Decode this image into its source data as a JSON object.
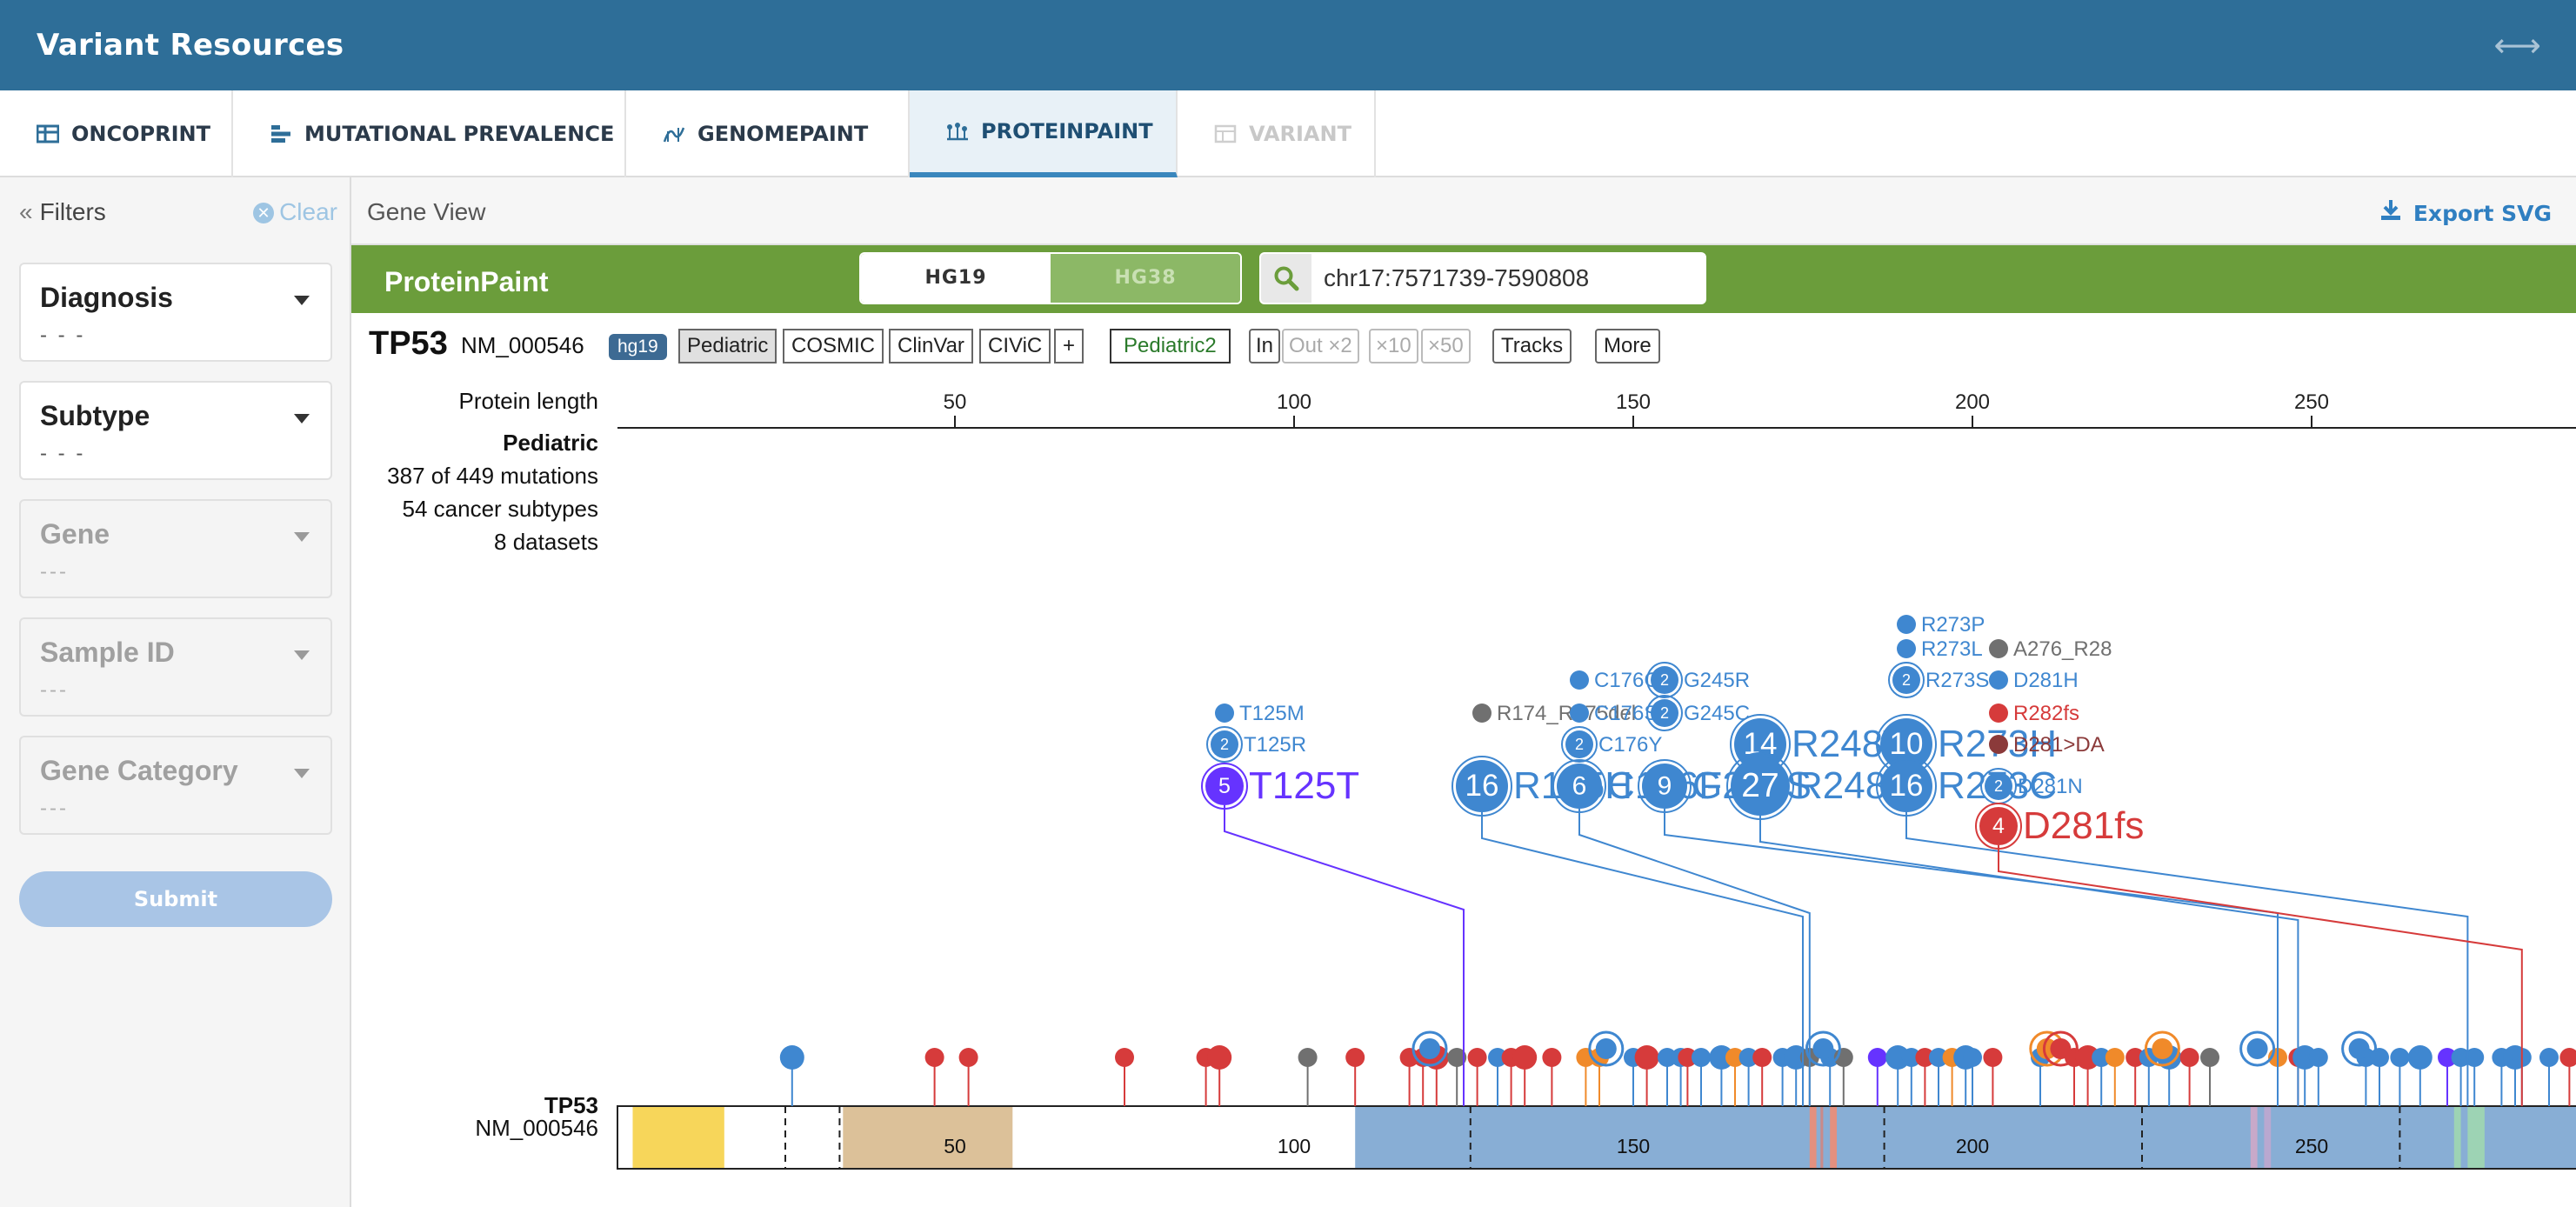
{
  "app": {
    "title": "Variant Resources"
  },
  "tabs": [
    {
      "label": "ONCOPRINT",
      "icon": "oncoprint-grid-icon",
      "state": "normal"
    },
    {
      "label": "MUTATIONAL PREVALENCE",
      "icon": "bar-list-icon",
      "state": "normal"
    },
    {
      "label": "GENOMEPAINT",
      "icon": "genomepaint-icon",
      "state": "normal"
    },
    {
      "label": "PROTEINPAINT",
      "icon": "lollipop-icon",
      "state": "active"
    },
    {
      "label": "VARIANT",
      "icon": "table-icon",
      "state": "disabled"
    }
  ],
  "sidebar": {
    "heading": "Filters",
    "clear_label": "Clear",
    "filters": [
      {
        "label": "Diagnosis",
        "value": "- - -",
        "enabled": true
      },
      {
        "label": "Subtype",
        "value": "- - -",
        "enabled": true
      },
      {
        "label": "Gene",
        "value": "---",
        "enabled": false
      },
      {
        "label": "Sample ID",
        "value": "---",
        "enabled": false
      },
      {
        "label": "Gene Category",
        "value": "---",
        "enabled": false
      }
    ],
    "submit_label": "Submit"
  },
  "gene_view": {
    "title": "Gene View",
    "export_label": "Export SVG"
  },
  "proteinpaint": {
    "title": "ProteinPaint",
    "genomes": [
      "HG19",
      "HG38"
    ],
    "selected_genome": "HG19",
    "search_value": "chr17:7571739-7590808"
  },
  "toolbar": {
    "gene": "TP53",
    "accession": "NM_000546",
    "genome_badge": "hg19",
    "track_buttons": [
      "Pediatric",
      "COSMIC",
      "ClinVar",
      "CIViC",
      "+"
    ],
    "pediatric2": "Pediatric2",
    "zoom_in": "In",
    "zoom_out": [
      "Out ×2",
      "×10",
      "×50"
    ],
    "tracks": "Tracks",
    "more": "More"
  },
  "protein_axis": {
    "label": "Protein length",
    "ticks": [
      50,
      100,
      150,
      200,
      250
    ]
  },
  "track_summary": {
    "name": "Pediatric",
    "mutations": "387 of 449 mutations",
    "subtypes": "54 cancer subtypes",
    "datasets": "8 datasets"
  },
  "domain_track": {
    "gene": "TP53",
    "accession": "NM_000546",
    "ticks": [
      50,
      100,
      150,
      200,
      250
    ]
  },
  "colors": {
    "header": "#2e6e98",
    "pp_green": "#6b9d3b",
    "missense": "#3f87d0",
    "frameshift": "#d63b3b",
    "silent": "#6633ff",
    "inframe": "#707070",
    "splice": "#f08a2a"
  },
  "labeled_mutations": [
    {
      "label": "T125M",
      "aa": 125,
      "count": 1,
      "color": "#3f87d0",
      "row": 1
    },
    {
      "label": "T125R",
      "aa": 125,
      "count": 2,
      "color": "#3f87d0",
      "row": 2
    },
    {
      "label": "T125T",
      "aa": 125,
      "count": 5,
      "color": "#6633ff",
      "row": 3
    },
    {
      "label": "R174_R175del",
      "aa": 175,
      "count": 1,
      "color": "#707070",
      "row": 1
    },
    {
      "label": "R175H",
      "aa": 175,
      "count": 16,
      "color": "#3f87d0",
      "row": 3
    },
    {
      "label": "C176G",
      "aa": 176,
      "count": 1,
      "color": "#3f87d0",
      "row": 0
    },
    {
      "label": "C176S",
      "aa": 176,
      "count": 1,
      "color": "#3f87d0",
      "row": 1
    },
    {
      "label": "C176Y",
      "aa": 176,
      "count": 2,
      "color": "#3f87d0",
      "row": 2
    },
    {
      "label": "C176F",
      "aa": 176,
      "count": 6,
      "color": "#3f87d0",
      "row": 3
    },
    {
      "label": "G245R",
      "aa": 245,
      "count": 2,
      "color": "#3f87d0",
      "row": 0
    },
    {
      "label": "G245C",
      "aa": 245,
      "count": 2,
      "color": "#3f87d0",
      "row": 1
    },
    {
      "label": "G245S",
      "aa": 245,
      "count": 9,
      "color": "#3f87d0",
      "row": 3
    },
    {
      "label": "R248W",
      "aa": 248,
      "count": 14,
      "color": "#3f87d0",
      "row": 2
    },
    {
      "label": "R248Q",
      "aa": 248,
      "count": 27,
      "color": "#3f87d0",
      "row": 3
    },
    {
      "label": "R273P",
      "aa": 273,
      "count": 1,
      "color": "#3f87d0",
      "row": -2
    },
    {
      "label": "R273L",
      "aa": 273,
      "count": 1,
      "color": "#3f87d0",
      "row": -1
    },
    {
      "label": "R273S",
      "aa": 273,
      "count": 2,
      "color": "#3f87d0",
      "row": 0
    },
    {
      "label": "R273H",
      "aa": 273,
      "count": 10,
      "color": "#3f87d0",
      "row": 2
    },
    {
      "label": "R273C",
      "aa": 273,
      "count": 16,
      "color": "#3f87d0",
      "row": 3
    },
    {
      "label": "A276_R28",
      "aa": 276,
      "count": 1,
      "color": "#707070",
      "row": -1
    },
    {
      "label": "D281H",
      "aa": 281,
      "count": 1,
      "color": "#3f87d0",
      "row": 0
    },
    {
      "label": "R282fs",
      "aa": 282,
      "count": 1,
      "color": "#d63b3b",
      "row": 1
    },
    {
      "label": "D281>DA",
      "aa": 281,
      "count": 1,
      "color": "#8b3a3a",
      "row": 2
    },
    {
      "label": "D281N",
      "aa": 281,
      "count": 2,
      "color": "#3f87d0",
      "row": 3
    },
    {
      "label": "D281fs",
      "aa": 281,
      "count": 4,
      "color": "#d63b3b",
      "row": 4
    }
  ]
}
